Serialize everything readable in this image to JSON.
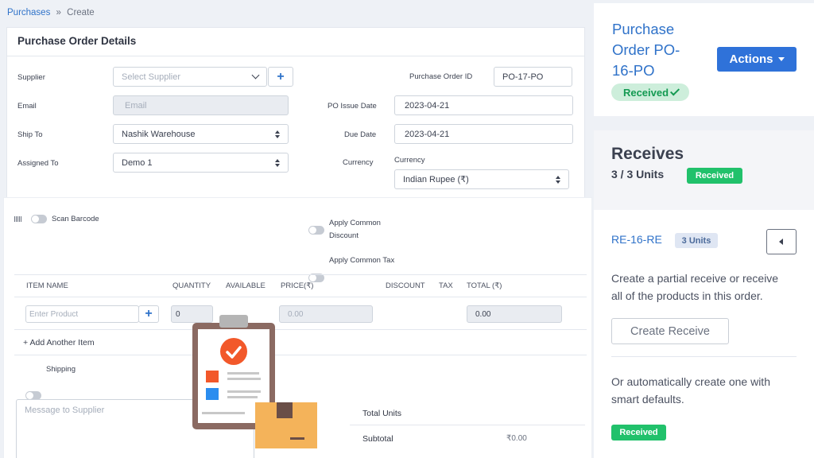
{
  "breadcrumb": {
    "parent": "Purchases",
    "separator": "»",
    "current": "Create"
  },
  "form": {
    "title": "Purchase Order Details",
    "supplier_label": "Supplier",
    "supplier_placeholder": "Select Supplier",
    "email_label": "Email",
    "email_placeholder": "Email",
    "ship_to_label": "Ship To",
    "ship_to_value": "Nashik Warehouse",
    "assigned_to_label": "Assigned To",
    "assigned_to_value": "Demo 1",
    "po_id_label": "Purchase Order ID",
    "po_id_value": "PO-17-PO",
    "issue_date_label": "PO Issue Date",
    "issue_date_value": "2023-04-21",
    "due_date_label": "Due Date",
    "due_date_value": "2023-04-21",
    "currency_label": "Currency",
    "currency_label2": "Currency",
    "currency_value": "Indian Rupee (₹)"
  },
  "items": {
    "scan_barcode": "Scan Barcode",
    "apply_discount_1": "Apply Common",
    "apply_discount_2": "Discount",
    "apply_tax": "Apply Common Tax",
    "columns": [
      "ITEM NAME",
      "QUANTITY",
      "AVAILABLE",
      "PRICE(₹)",
      "DISCOUNT",
      "TAX",
      "TOTAL (₹)"
    ],
    "product_placeholder": "Enter Product",
    "quantity_value": "0",
    "price_value": "0.00",
    "total_value": "0.00",
    "add_item": "+ Add Another Item",
    "shipping": "Shipping",
    "message_placeholder": "Message to Supplier",
    "total_units_label": "Total Units",
    "subtotal_label": "Subtotal",
    "subtotal_value": "₹0.00"
  },
  "order_panel": {
    "title_1": "Purchase",
    "title_2": "Order PO-",
    "title_3": "16-PO",
    "status": "Received",
    "actions_label": "Actions"
  },
  "receives_panel": {
    "title": "Receives",
    "units": "3 / 3 Units",
    "status": "Received",
    "receive_id": "RE-16-RE",
    "receive_units": "3 Units",
    "desc_1": "Create a partial receive or receive",
    "desc_2": "all of the products in this order.",
    "create_button": "Create Receive",
    "auto_1": "Or automatically create one with",
    "auto_2": "smart defaults.",
    "bottom_status": "Received"
  },
  "colors": {
    "accent": "#2f72c9",
    "success": "#21c16b",
    "button": "#2f72d9"
  }
}
